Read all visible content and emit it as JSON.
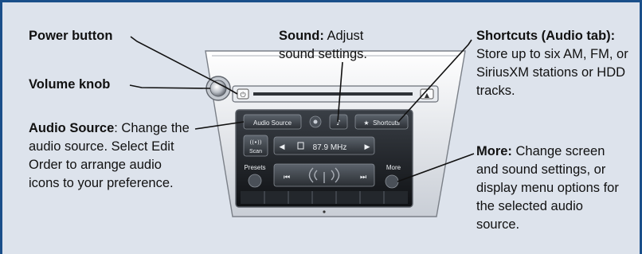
{
  "callouts": {
    "power": {
      "title": "Power button",
      "text": ""
    },
    "volume": {
      "title": "Volume knob",
      "text": ""
    },
    "audio_source": {
      "title": "Audio Source",
      "text": ": Change the audio source. Select Edit Order to arrange audio icons to your preference."
    },
    "sound": {
      "title": "Sound:",
      "text": " Adjust sound settings."
    },
    "shortcuts": {
      "title": "Shortcuts (Audio tab):",
      "text": " Store up to six AM, FM, or SiriusXM stations or HDD tracks."
    },
    "more": {
      "title": "More:",
      "text": " Change screen and sound settings, or display menu options for the selected audio source."
    }
  },
  "screen": {
    "audio_source_label": "Audio Source",
    "shortcuts_label": "Shortcuts",
    "scan_label": "Scan",
    "frequency": "87.9 MHz",
    "presets_label": "Presets",
    "more_label": "More"
  },
  "colors": {
    "border": "#1a4f8a",
    "background": "#dde3ec",
    "leader": "#111111"
  }
}
